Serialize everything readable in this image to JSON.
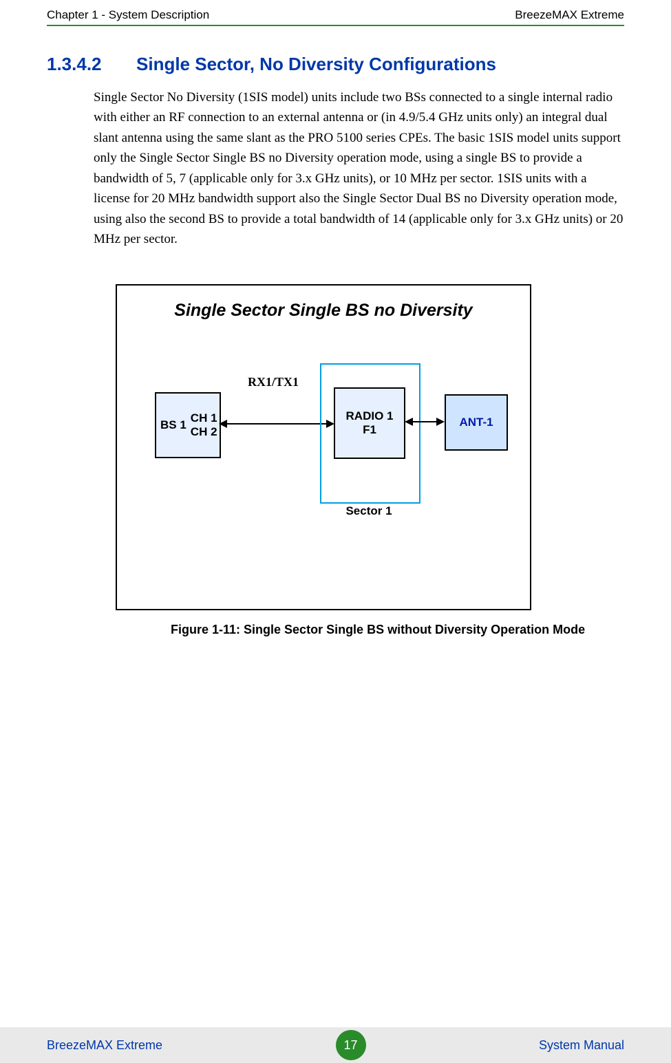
{
  "header": {
    "left": "Chapter 1 - System Description",
    "right": "BreezeMAX Extreme"
  },
  "section": {
    "number": "1.3.4.2",
    "title": "Single Sector, No Diversity Configurations"
  },
  "body": "Single Sector No Diversity (1SIS model) units include two BSs connected to a single internal radio with either an RF connection to an external antenna or (in 4.9/5.4 GHz units only) an integral dual slant antenna using the same slant as the PRO 5100 series CPEs. The basic 1SIS model units support only the Single Sector Single BS no Diversity operation mode, using a single BS to provide a bandwidth of 5, 7 (applicable only for 3.x GHz units), or 10 MHz per sector. 1SIS units with a license for 20 MHz bandwidth support also the Single Sector Dual BS no Diversity operation mode, using also the second BS to provide a total bandwidth of 14 (applicable only for 3.x GHz units) or 20 MHz per sector.",
  "diagram": {
    "title": "Single Sector Single BS no Diversity",
    "bs_label": "BS 1",
    "bs_ch1": "CH 1",
    "bs_ch2": "CH 2",
    "rxtx": "RX1/TX1",
    "radio_line1": "RADIO 1",
    "radio_line2": "F1",
    "sector": "Sector 1",
    "ant": "ANT-1"
  },
  "figure_caption": "Figure 1-11: Single Sector Single BS without Diversity Operation Mode",
  "footer": {
    "left": "BreezeMAX Extreme",
    "page": "17",
    "right": "System Manual"
  }
}
